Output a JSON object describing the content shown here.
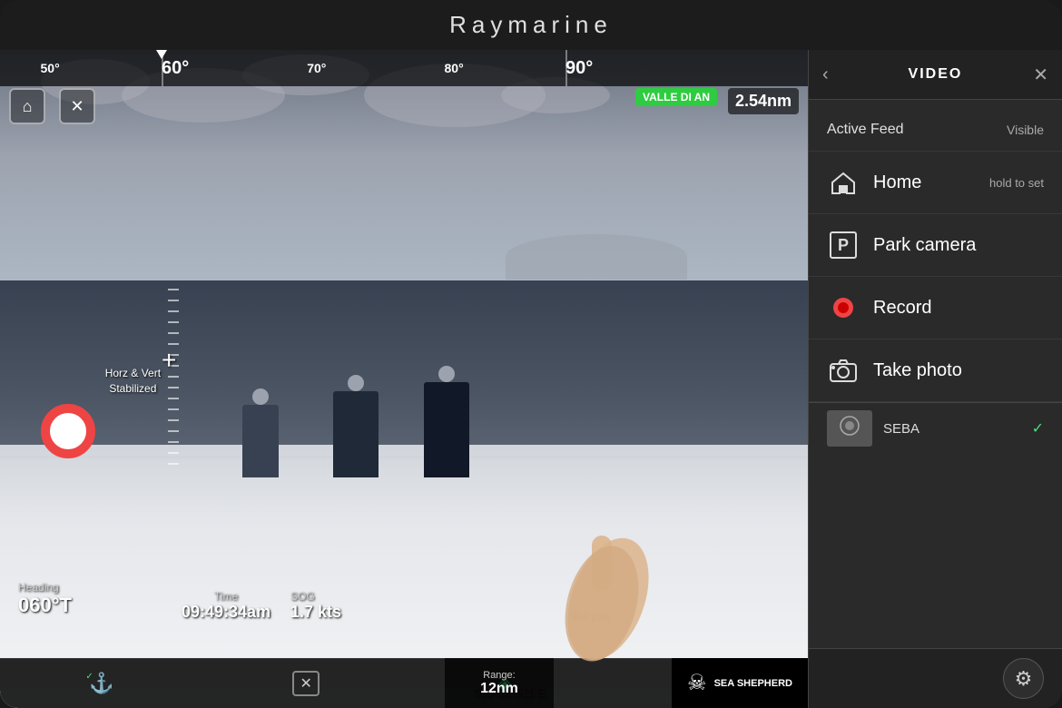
{
  "device": {
    "brand": "Raymarine"
  },
  "header": {
    "back_icon": "‹",
    "title": "VIDEO",
    "close_icon": "✕"
  },
  "camera": {
    "heading_label": "Heading",
    "heading_value": "060°T",
    "time_label": "Time",
    "time_value": "09:49:34am",
    "sog_label": "SOG",
    "sog_value": "1.7 kts",
    "ves_pos_label": "Ves pos",
    "compass_degrees": [
      "50°",
      "60°",
      "70°",
      "80°",
      "90°"
    ],
    "main_degree": "60°",
    "distance": "2.54nm",
    "vessel_name": "VALLE DI AN",
    "stabilized_line1": "Horz & Vert",
    "stabilized_line2": "Stabilized"
  },
  "panel": {
    "active_feed_label": "Active Feed",
    "active_feed_status": "Visible",
    "menu_items": [
      {
        "id": "home",
        "icon": "⌂",
        "label": "Home",
        "sublabel": "hold to set",
        "icon_type": "house"
      },
      {
        "id": "park",
        "icon": "P",
        "label": "Park camera",
        "sublabel": "",
        "icon_type": "parking"
      },
      {
        "id": "record",
        "icon": "●",
        "label": "Record",
        "sublabel": "",
        "icon_type": "record"
      },
      {
        "id": "photo",
        "icon": "📷",
        "label": "Take photo",
        "sublabel": "",
        "icon_type": "camera"
      }
    ],
    "camera_feed": {
      "name": "SEBA",
      "check": "✓"
    }
  },
  "toolbar": {
    "items": [
      {
        "id": "anchor",
        "icon": "⚓",
        "active": true
      },
      {
        "id": "close",
        "icon": "✕",
        "active": false
      },
      {
        "id": "map",
        "icon": "◈",
        "active": true
      },
      {
        "id": "bracket",
        "icon": "[ ]",
        "active": false
      }
    ]
  },
  "bottom_right": {
    "range_label": "Range:",
    "range_value": "12nm",
    "coords": "015°1...511 E",
    "sea_shepherd": "SEA SHEPHERD"
  },
  "gear": {
    "icon": "⚙"
  }
}
